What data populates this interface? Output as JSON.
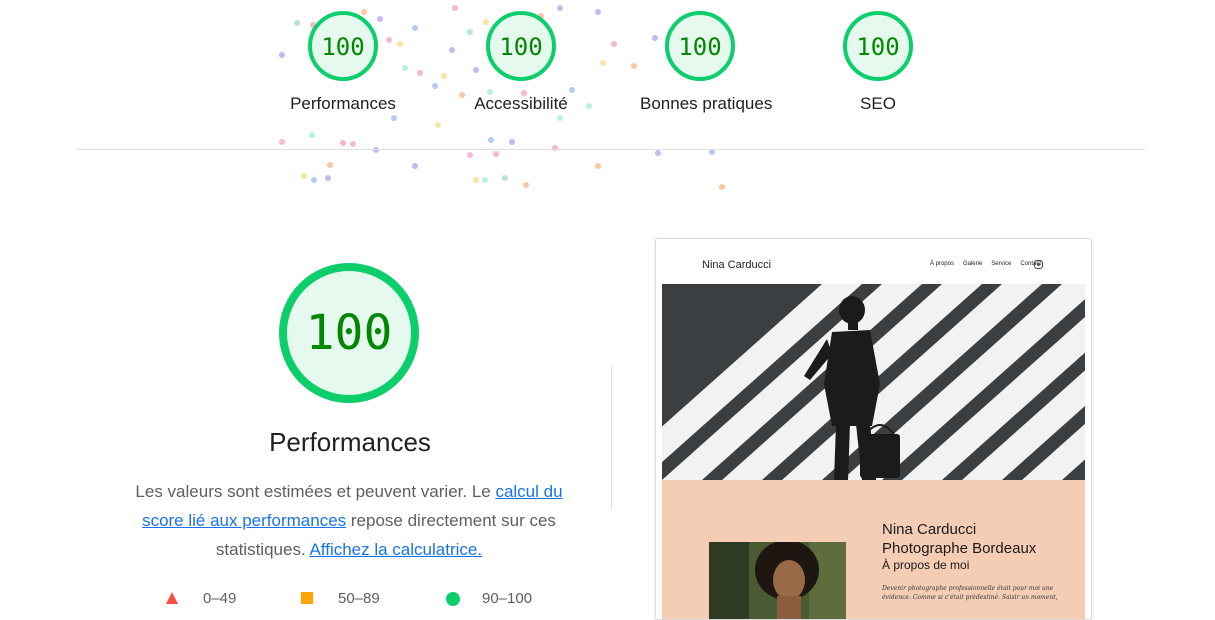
{
  "summary": {
    "gauges": [
      {
        "score": "100",
        "label": "Performances"
      },
      {
        "score": "100",
        "label": "Accessibilité"
      },
      {
        "score": "100",
        "label": "Bonnes pratiques"
      },
      {
        "score": "100",
        "label": "SEO"
      }
    ]
  },
  "performance": {
    "score": "100",
    "title": "Performances",
    "desc_part1": "Les valeurs sont estimées et peuvent varier. Le ",
    "link_calc": "calcul du score lié aux performances",
    "desc_part2": " repose directement sur ces statistiques. ",
    "link_calculator": "Affichez la calculatrice.",
    "legend": [
      {
        "icon": "fail-triangle-icon",
        "label": "0–49"
      },
      {
        "icon": "average-square-icon",
        "label": "50–89"
      },
      {
        "icon": "pass-circle-icon",
        "label": "90–100"
      }
    ]
  },
  "screenshot": {
    "brand": "Nina Carducci",
    "nav": [
      "À propos",
      "Galerie",
      "Service",
      "Contact"
    ],
    "about_name_line1": "Nina Carducci",
    "about_name_line2": "Photographe Bordeaux",
    "about_sub": "À propos de moi",
    "about_text": "Devenir photographe professionnelle était pour moi une évidence. Comme si c'était prédestiné. Saisir un moment,"
  },
  "colors": {
    "pass": "#0cce6b",
    "pass_fill": "#e6f9ee",
    "pass_text": "#008800",
    "average": "#ffa400",
    "fail": "#ff4e42",
    "link": "#1a73e8",
    "about_bg": "#f5cdb4"
  }
}
